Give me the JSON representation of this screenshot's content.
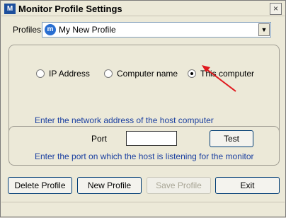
{
  "window": {
    "title": "Monitor Profile Settings",
    "close_label": "×"
  },
  "profiles": {
    "label": "Profiles",
    "selected": "My New Profile",
    "icon": "profile-app-icon"
  },
  "host": {
    "options": [
      {
        "label": "IP Address",
        "selected": false
      },
      {
        "label": "Computer name",
        "selected": false
      },
      {
        "label": "This computer",
        "selected": true
      }
    ],
    "hint": "Enter the network address of the host computer"
  },
  "port": {
    "label": "Port",
    "value": "",
    "test_label": "Test",
    "hint": "Enter the port on which the host is listening for the monitor"
  },
  "buttons": {
    "delete": "Delete Profile",
    "new": "New Profile",
    "save": "Save Profile",
    "exit": "Exit"
  },
  "annotation": {
    "color": "#e0191e"
  }
}
